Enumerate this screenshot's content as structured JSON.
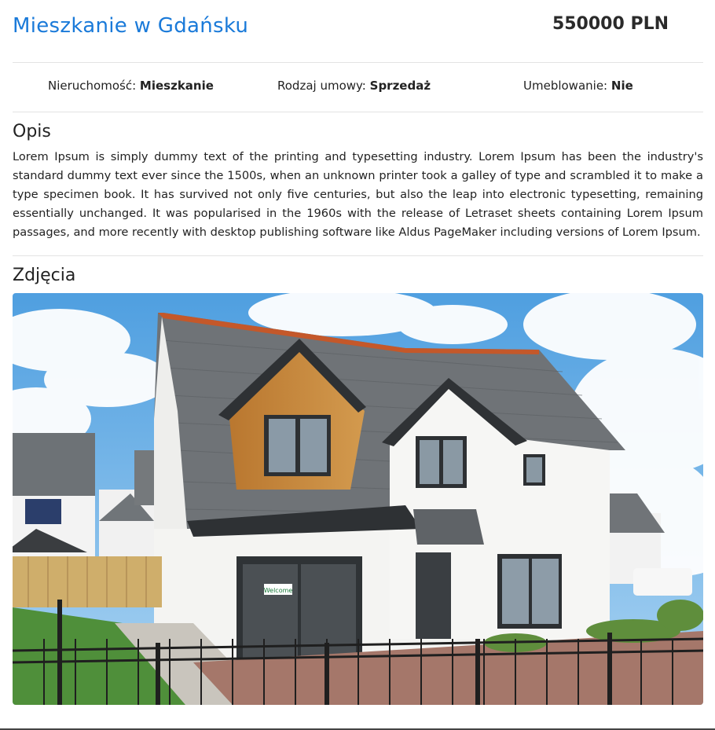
{
  "listing": {
    "title": "Mieszkanie w Gdańsku",
    "price": "550000 PLN"
  },
  "properties": [
    {
      "label": "Nieruchomość:",
      "value": "Mieszkanie"
    },
    {
      "label": "Rodzaj umowy:",
      "value": "Sprzedaż"
    },
    {
      "label": "Umeblowanie:",
      "value": "Nie"
    }
  ],
  "description": {
    "heading": "Opis",
    "text": "Lorem Ipsum is simply dummy text of the printing and typesetting industry. Lorem Ipsum has been the industry's standard dummy text ever since the 1500s, when an unknown printer took a galley of type and scrambled it to make a type specimen book. It has survived not only five centuries, but also the leap into electronic typesetting, remaining essentially unchanged. It was popularised in the 1960s with the release of Letraset sheets containing Lorem Ipsum passages, and more recently with desktop publishing software like Aldus PageMaker including versions of Lorem Ipsum."
  },
  "photos": {
    "heading": "Zdjęcia",
    "images": [
      {
        "name": "house-photo",
        "sign_text": "Welcome"
      }
    ]
  },
  "colors": {
    "title": "#1a7ad9",
    "divider": "#e3e3e3"
  }
}
